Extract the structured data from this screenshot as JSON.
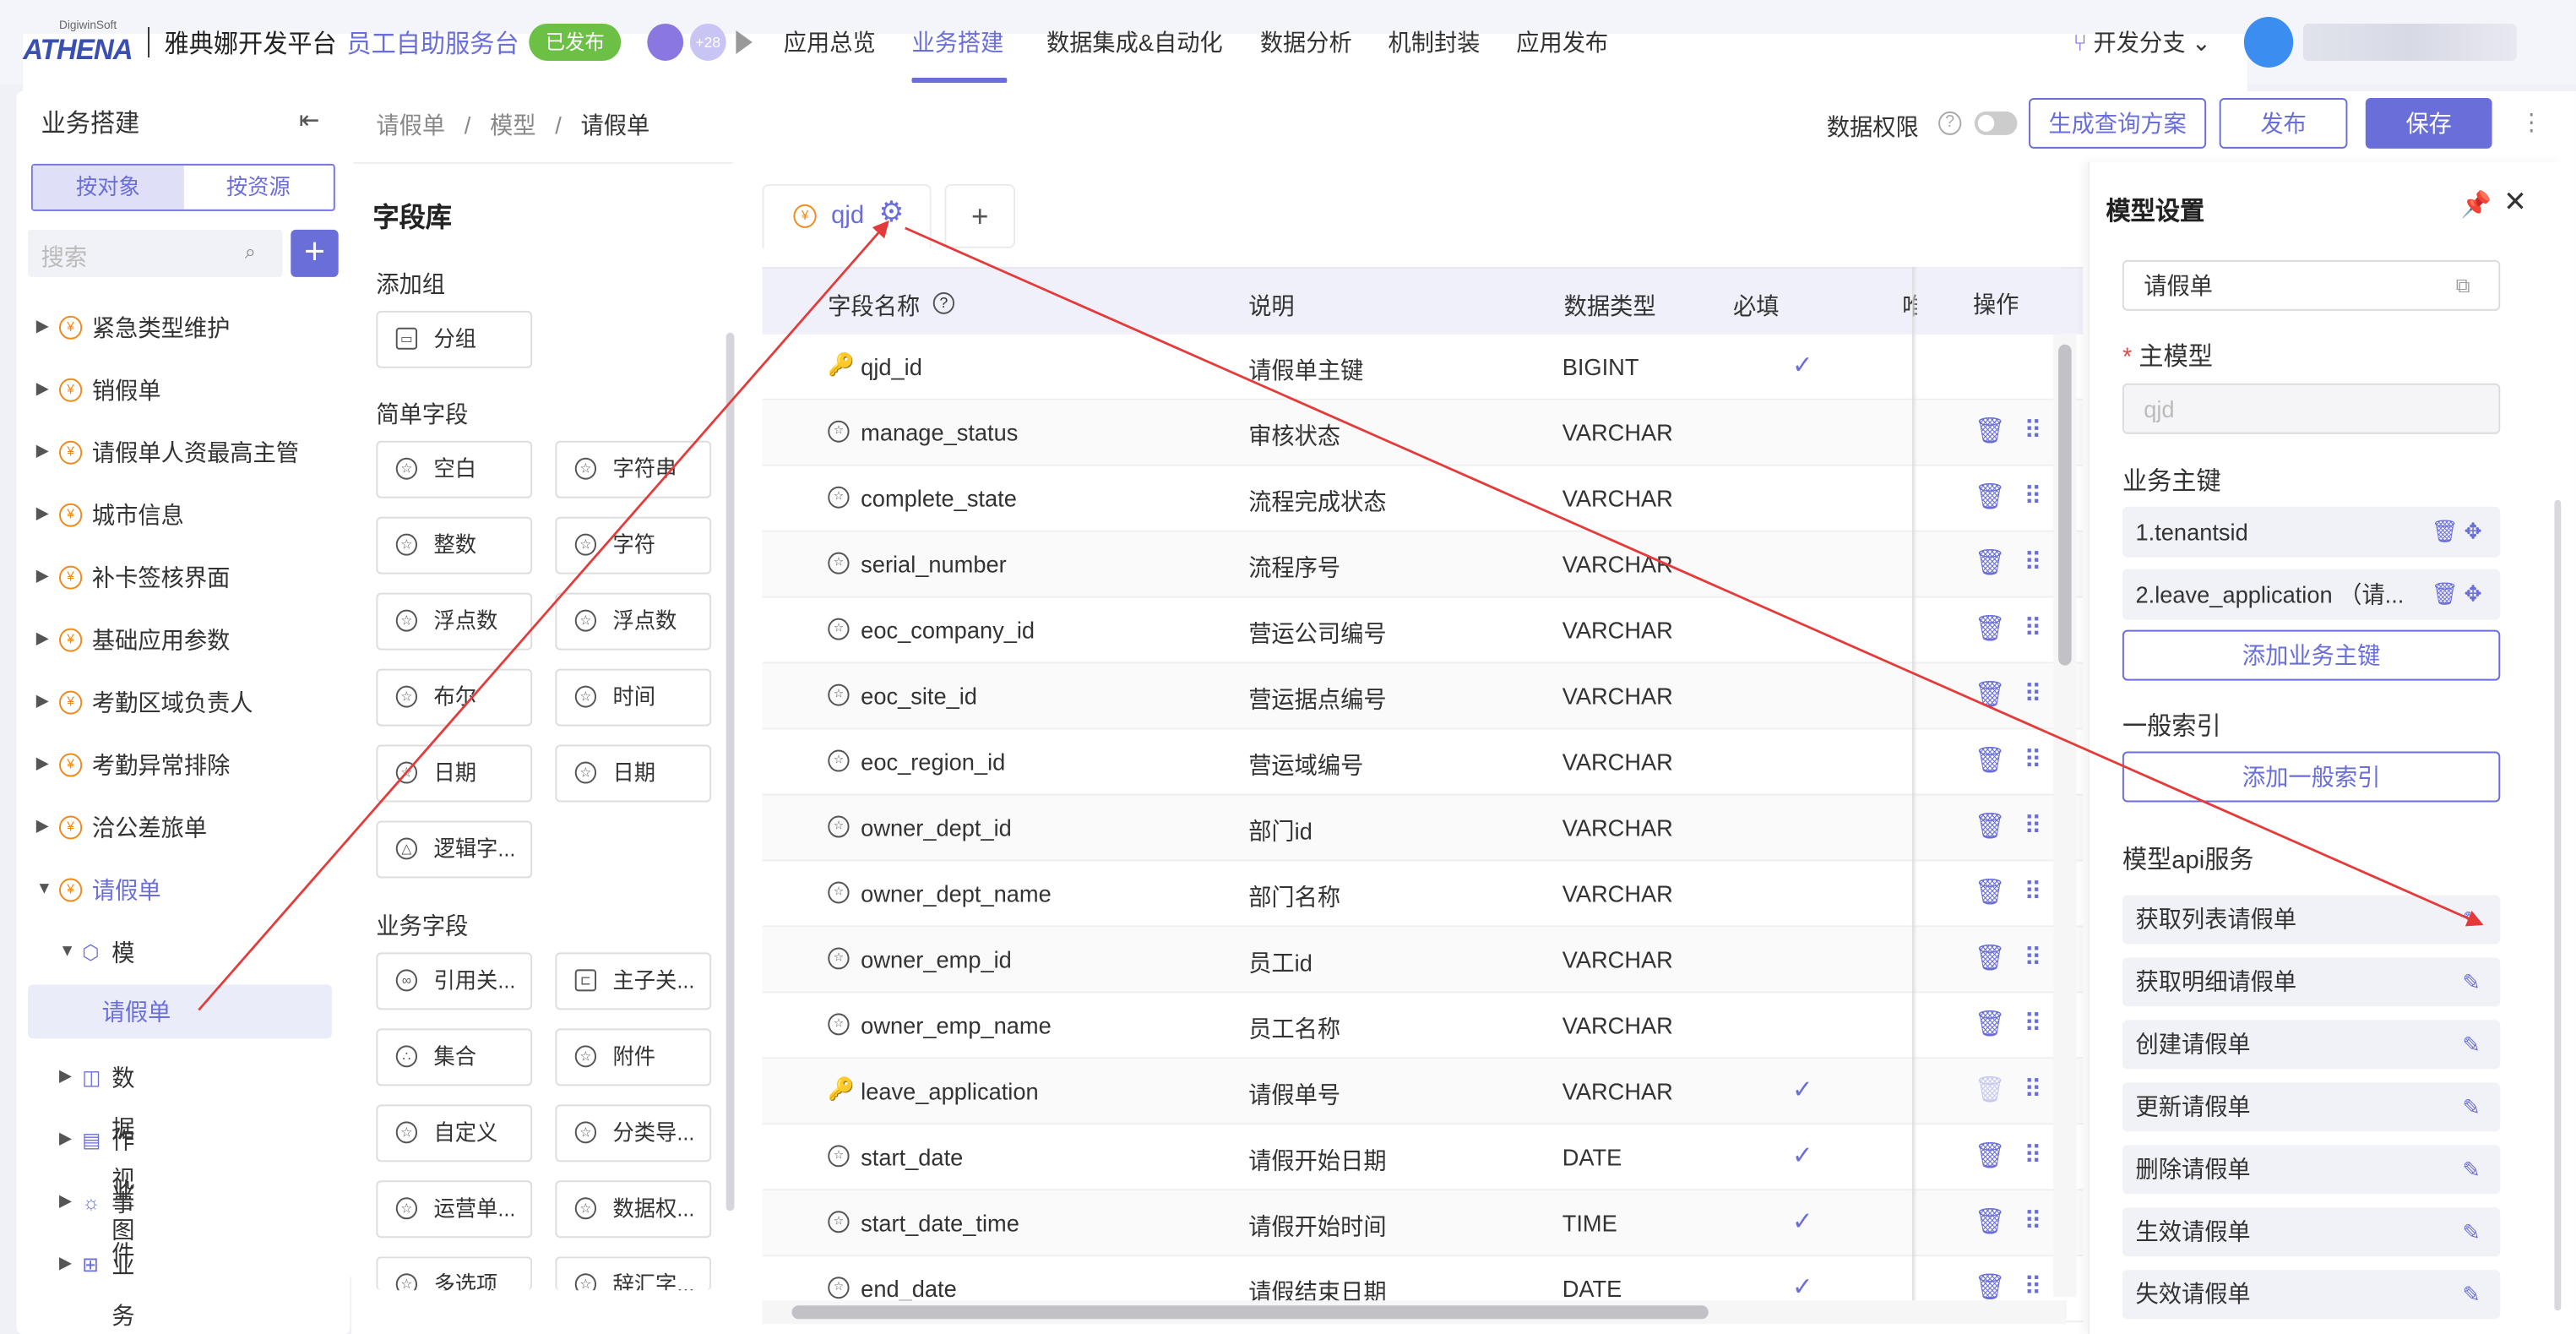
{
  "topbar": {
    "logo_sup": "DigiwinSoft",
    "logo_main": "ATHENA",
    "platform": "雅典娜开发平台",
    "app_name": "员工自助服务台",
    "published_badge": "已发布",
    "avatar_more": "+28",
    "nav": [
      "应用总览",
      "业务搭建",
      "数据集成&自动化",
      "数据分析",
      "机制封装",
      "应用发布"
    ],
    "active_nav": "业务搭建",
    "branch": "开发分支 ⌄"
  },
  "sidebar": {
    "title": "业务搭建",
    "seg": [
      "按对象",
      "按资源"
    ],
    "search_placeholder": "搜索",
    "items": [
      "紧急类型维护",
      "销假单",
      "请假单人资最高主管",
      "城市信息",
      "补卡签核界面",
      "基础应用参数",
      "考勤区域负责人",
      "考勤异常排除",
      "洽公差旅单",
      "请假单"
    ],
    "model_label": "模型",
    "model_leaf": "请假单",
    "sub": [
      "数据视图",
      "作业",
      "事件",
      "业务流"
    ]
  },
  "header": {
    "crumbs": [
      "请假单",
      "模型",
      "请假单"
    ],
    "perm_label": "数据权限",
    "btn_query": "生成查询方案",
    "btn_publish": "发布",
    "btn_save": "保存"
  },
  "fieldlib": {
    "title": "字段库",
    "sec_group": "添加组",
    "group_btn": "分组",
    "sec_simple": "简单字段",
    "simple": [
      "空白",
      "字符串",
      "整数",
      "字符",
      "浮点数",
      "浮点数",
      "布尔",
      "时间",
      "日期",
      "日期",
      "逻辑字..."
    ],
    "sec_biz": "业务字段",
    "biz": [
      "引用关...",
      "主子关...",
      "集合",
      "附件",
      "自定义",
      "分类导...",
      "运营单...",
      "数据权...",
      "多选项",
      "辞汇字..."
    ]
  },
  "tab": {
    "label": "qjd"
  },
  "table": {
    "headers": [
      "字段名称",
      "说明",
      "数据类型",
      "必填",
      "唯",
      "操作"
    ],
    "rows": [
      {
        "name": "qjd_id",
        "desc": "请假单主键",
        "type": "BIGINT"
      },
      {
        "name": "manage_status",
        "desc": "审核状态",
        "type": "VARCHAR"
      },
      {
        "name": "complete_state",
        "desc": "流程完成状态",
        "type": "VARCHAR"
      },
      {
        "name": "serial_number",
        "desc": "流程序号",
        "type": "VARCHAR"
      },
      {
        "name": "eoc_company_id",
        "desc": "营运公司编号",
        "type": "VARCHAR"
      },
      {
        "name": "eoc_site_id",
        "desc": "营运据点编号",
        "type": "VARCHAR"
      },
      {
        "name": "eoc_region_id",
        "desc": "营运域编号",
        "type": "VARCHAR"
      },
      {
        "name": "owner_dept_id",
        "desc": "部门id",
        "type": "VARCHAR"
      },
      {
        "name": "owner_dept_name",
        "desc": "部门名称",
        "type": "VARCHAR"
      },
      {
        "name": "owner_emp_id",
        "desc": "员工id",
        "type": "VARCHAR"
      },
      {
        "name": "owner_emp_name",
        "desc": "员工名称",
        "type": "VARCHAR"
      },
      {
        "name": "leave_application",
        "desc": "请假单号",
        "type": "VARCHAR"
      },
      {
        "name": "start_date",
        "desc": "请假开始日期",
        "type": "DATE"
      },
      {
        "name": "start_date_time",
        "desc": "请假开始时间",
        "type": "TIME"
      },
      {
        "name": "end_date",
        "desc": "请假结束日期",
        "type": "DATE"
      }
    ]
  },
  "model_settings": {
    "title": "模型设置",
    "name_value": "请假单",
    "main_model_label": "主模型",
    "main_model_value": "qjd",
    "bizkey_label": "业务主键",
    "keys": [
      "1.tenantsid",
      "2.leave_application （请..."
    ],
    "add_key": "添加业务主键",
    "index_label": "一般索引",
    "add_index": "添加一般索引",
    "api_label": "模型api服务",
    "services": [
      "获取列表请假单",
      "获取明细请假单",
      "创建请假单",
      "更新请假单",
      "删除请假单",
      "生效请假单",
      "失效请假单"
    ]
  },
  "colors": {
    "accent": "#6a6ed8",
    "published": "#6cc046",
    "orange_icon": "#ef8a1e",
    "annotation_arrow": "#e43a3a"
  }
}
